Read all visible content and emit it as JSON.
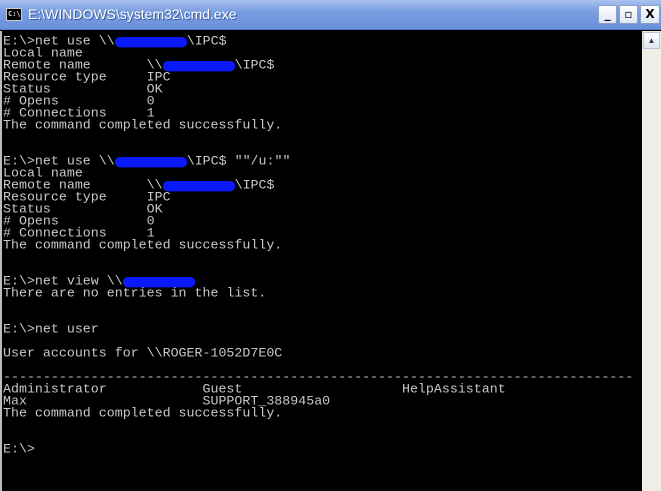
{
  "window": {
    "title": "E:\\WINDOWS\\system32\\cmd.exe",
    "icon": "cmd-icon",
    "icon_text": "C:\\",
    "minimize": "_",
    "maximize": "▫",
    "close": "X"
  },
  "console": {
    "lines": [
      [
        {
          "t": "E:\\>net use \\\\"
        },
        {
          "r": 9
        },
        {
          "t": "\\IPC$"
        }
      ],
      [
        {
          "t": "Local name"
        }
      ],
      [
        {
          "t": "Remote name       \\\\"
        },
        {
          "r": 9
        },
        {
          "t": "\\IPC$"
        }
      ],
      [
        {
          "t": "Resource type     IPC"
        }
      ],
      [
        {
          "t": "Status            OK"
        }
      ],
      [
        {
          "t": "# Opens           0"
        }
      ],
      [
        {
          "t": "# Connections     1"
        }
      ],
      [
        {
          "t": "The command completed successfully."
        }
      ],
      [],
      [],
      [
        {
          "t": "E:\\>net use \\\\"
        },
        {
          "r": 9
        },
        {
          "t": "\\IPC$ \"\"/u:\"\""
        }
      ],
      [
        {
          "t": "Local name"
        }
      ],
      [
        {
          "t": "Remote name       \\\\"
        },
        {
          "r": 9
        },
        {
          "t": "\\IPC$"
        }
      ],
      [
        {
          "t": "Resource type     IPC"
        }
      ],
      [
        {
          "t": "Status            OK"
        }
      ],
      [
        {
          "t": "# Opens           0"
        }
      ],
      [
        {
          "t": "# Connections     1"
        }
      ],
      [
        {
          "t": "The command completed successfully."
        }
      ],
      [],
      [],
      [
        {
          "t": "E:\\>net view \\\\"
        },
        {
          "r": 9
        }
      ],
      [
        {
          "t": "There are no entries in the list."
        }
      ],
      [],
      [],
      [
        {
          "t": "E:\\>net user"
        }
      ],
      [],
      [
        {
          "t": "User accounts for \\\\ROGER-1052D7E0C"
        }
      ],
      [],
      [
        {
          "t": "-------------------------------------------------------------------------------"
        }
      ],
      [
        {
          "t": "Administrator            Guest                    HelpAssistant"
        }
      ],
      [
        {
          "t": "Max                      SUPPORT_388945a0"
        }
      ],
      [
        {
          "t": "The command completed successfully."
        }
      ],
      [],
      [],
      [
        {
          "t": "E:\\>"
        }
      ]
    ]
  },
  "scrollbar": {
    "up_arrow": "▲"
  }
}
